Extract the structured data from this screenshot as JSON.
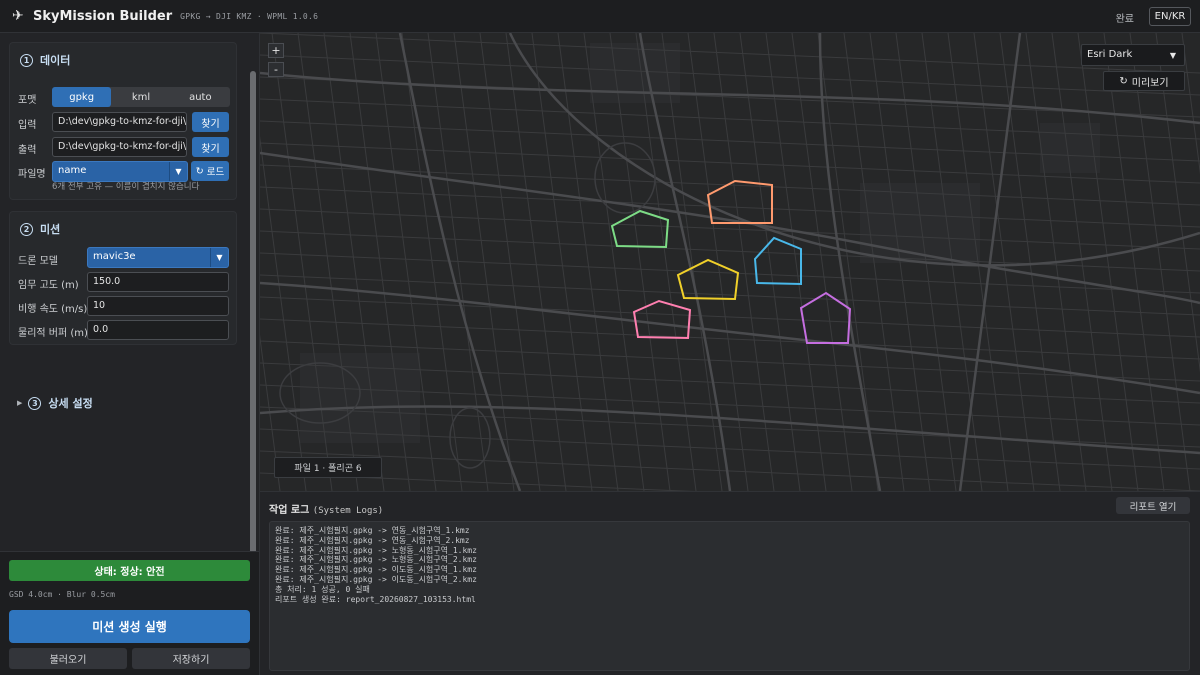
{
  "header": {
    "title": "SkyMission Builder",
    "subtitle": "GPKG → DJI KMZ · WPML 1.0.6",
    "status": "완료",
    "lang_button": "EN/KR",
    "logo_icon": "airplane-icon"
  },
  "data_section": {
    "number": "1",
    "title": "데이터",
    "format_label": "포맷",
    "formats": [
      "gpkg",
      "kml",
      "auto"
    ],
    "format_selected": "gpkg",
    "input_label": "입력",
    "input_value": "D:\\dev\\gpkg-to-kmz-for-dji\\input",
    "input_button": "찾기",
    "output_label": "출력",
    "output_value": "D:\\dev\\gpkg-to-kmz-for-dji\\output",
    "output_button": "찾기",
    "filename_label": "파일명",
    "filename_value": "name",
    "load_button": "로드",
    "hint": "6개 전부 고유 — 이름이 겹치지 않습니다"
  },
  "mission_section": {
    "number": "2",
    "title": "미션",
    "drone_label": "드론 모델",
    "drone_value": "mavic3e",
    "altitude_label": "임무 고도 (m)",
    "altitude_value": "150.0",
    "speed_label": "비행 속도 (m/s)",
    "speed_value": "10",
    "buffer_label": "물리적 버퍼 (m)",
    "buffer_value": "0.0"
  },
  "advanced_section": {
    "number": "3",
    "title": "상세 설정"
  },
  "footer": {
    "status": "상태: 정상: 안전",
    "gsd": "GSD 4.0cm · Blur 0.5cm",
    "run_button": "미션 생성 실행",
    "load_button": "불러오기",
    "save_button": "저장하기"
  },
  "map": {
    "zoom_in": "+",
    "zoom_out": "-",
    "basemap": "Esri Dark",
    "preview_button": "미리보기",
    "info": "파일 1 · 폴리곤 6",
    "polygon_colors": [
      "#ff9a6e",
      "#7ddc86",
      "#f0d02a",
      "#49b8ea",
      "#ff7fb0",
      "#c56ee0"
    ]
  },
  "logs": {
    "title": "작업 로그",
    "title_en": "(System Logs)",
    "report_button": "리포트 열기",
    "lines": [
      "완료: 제주_시험필지.gpkg -> 연동_시험구역_1.kmz",
      "완료: 제주_시험필지.gpkg -> 연동_시험구역_2.kmz",
      "완료: 제주_시험필지.gpkg -> 노형동_시험구역_1.kmz",
      "완료: 제주_시험필지.gpkg -> 노형동_시험구역_2.kmz",
      "완료: 제주_시험필지.gpkg -> 이도동_시험구역_1.kmz",
      "완료: 제주_시험필지.gpkg -> 이도동_시험구역_2.kmz",
      "총 처리: 1 성공, 0 실패",
      "리포트 생성 완료: report_20260827_103153.html"
    ]
  }
}
